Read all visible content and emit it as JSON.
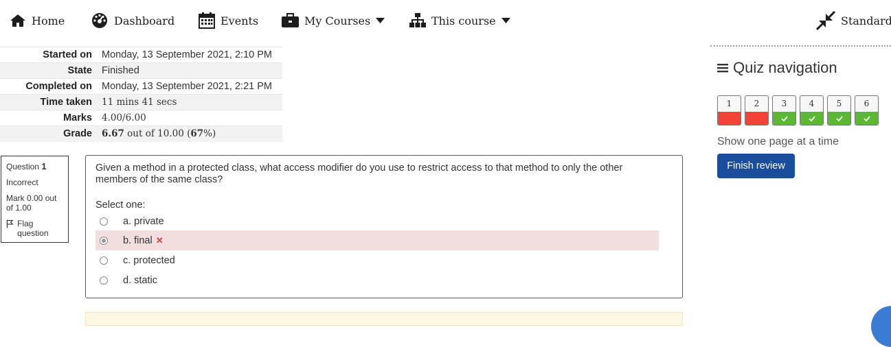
{
  "nav": {
    "home": "Home",
    "dashboard": "Dashboard",
    "events": "Events",
    "my_courses": "My Courses",
    "this_course": "This course",
    "standard": "Standard v"
  },
  "summary": {
    "rows": [
      {
        "label": "Started on",
        "value": "Monday, 13 September 2021, 2:10 PM"
      },
      {
        "label": "State",
        "value": "Finished"
      },
      {
        "label": "Completed on",
        "value": "Monday, 13 September 2021, 2:21 PM"
      },
      {
        "label": "Time taken",
        "value": "11 mins 41 secs"
      },
      {
        "label": "Marks",
        "value": "4.00/6.00"
      },
      {
        "label": "Grade",
        "value_bold": "6.67",
        "value_mid": " out of 10.00 (",
        "value_pct": "67",
        "value_end": "%)"
      }
    ]
  },
  "question_info": {
    "prefix": "Question ",
    "number": "1",
    "state": "Incorrect",
    "mark": "Mark 0.00 out of 1.00",
    "flag": "Flag question"
  },
  "question": {
    "text": "Given a method in a protected class, what access modifier do you use to restrict access to that method to only the other members of the same class?",
    "prompt": "Select one:",
    "answers": [
      {
        "label": "a. private",
        "checked": false,
        "incorrect": false
      },
      {
        "label": "b. final",
        "checked": true,
        "incorrect": true
      },
      {
        "label": "c. protected",
        "checked": false,
        "incorrect": false
      },
      {
        "label": "d. static",
        "checked": false,
        "incorrect": false
      }
    ]
  },
  "quiz_nav": {
    "title": "Quiz navigation",
    "buttons": [
      {
        "num": "1",
        "state": "incorrect"
      },
      {
        "num": "2",
        "state": "incorrect"
      },
      {
        "num": "3",
        "state": "correct"
      },
      {
        "num": "4",
        "state": "correct"
      },
      {
        "num": "5",
        "state": "correct"
      },
      {
        "num": "6",
        "state": "correct"
      }
    ],
    "show_one_page": "Show one page at a time",
    "finish_review": "Finish review"
  },
  "colors": {
    "incorrect": "#f44336",
    "correct": "#5bb833",
    "primary": "#1a4d9c",
    "incorrect_bg": "#f2dede"
  }
}
